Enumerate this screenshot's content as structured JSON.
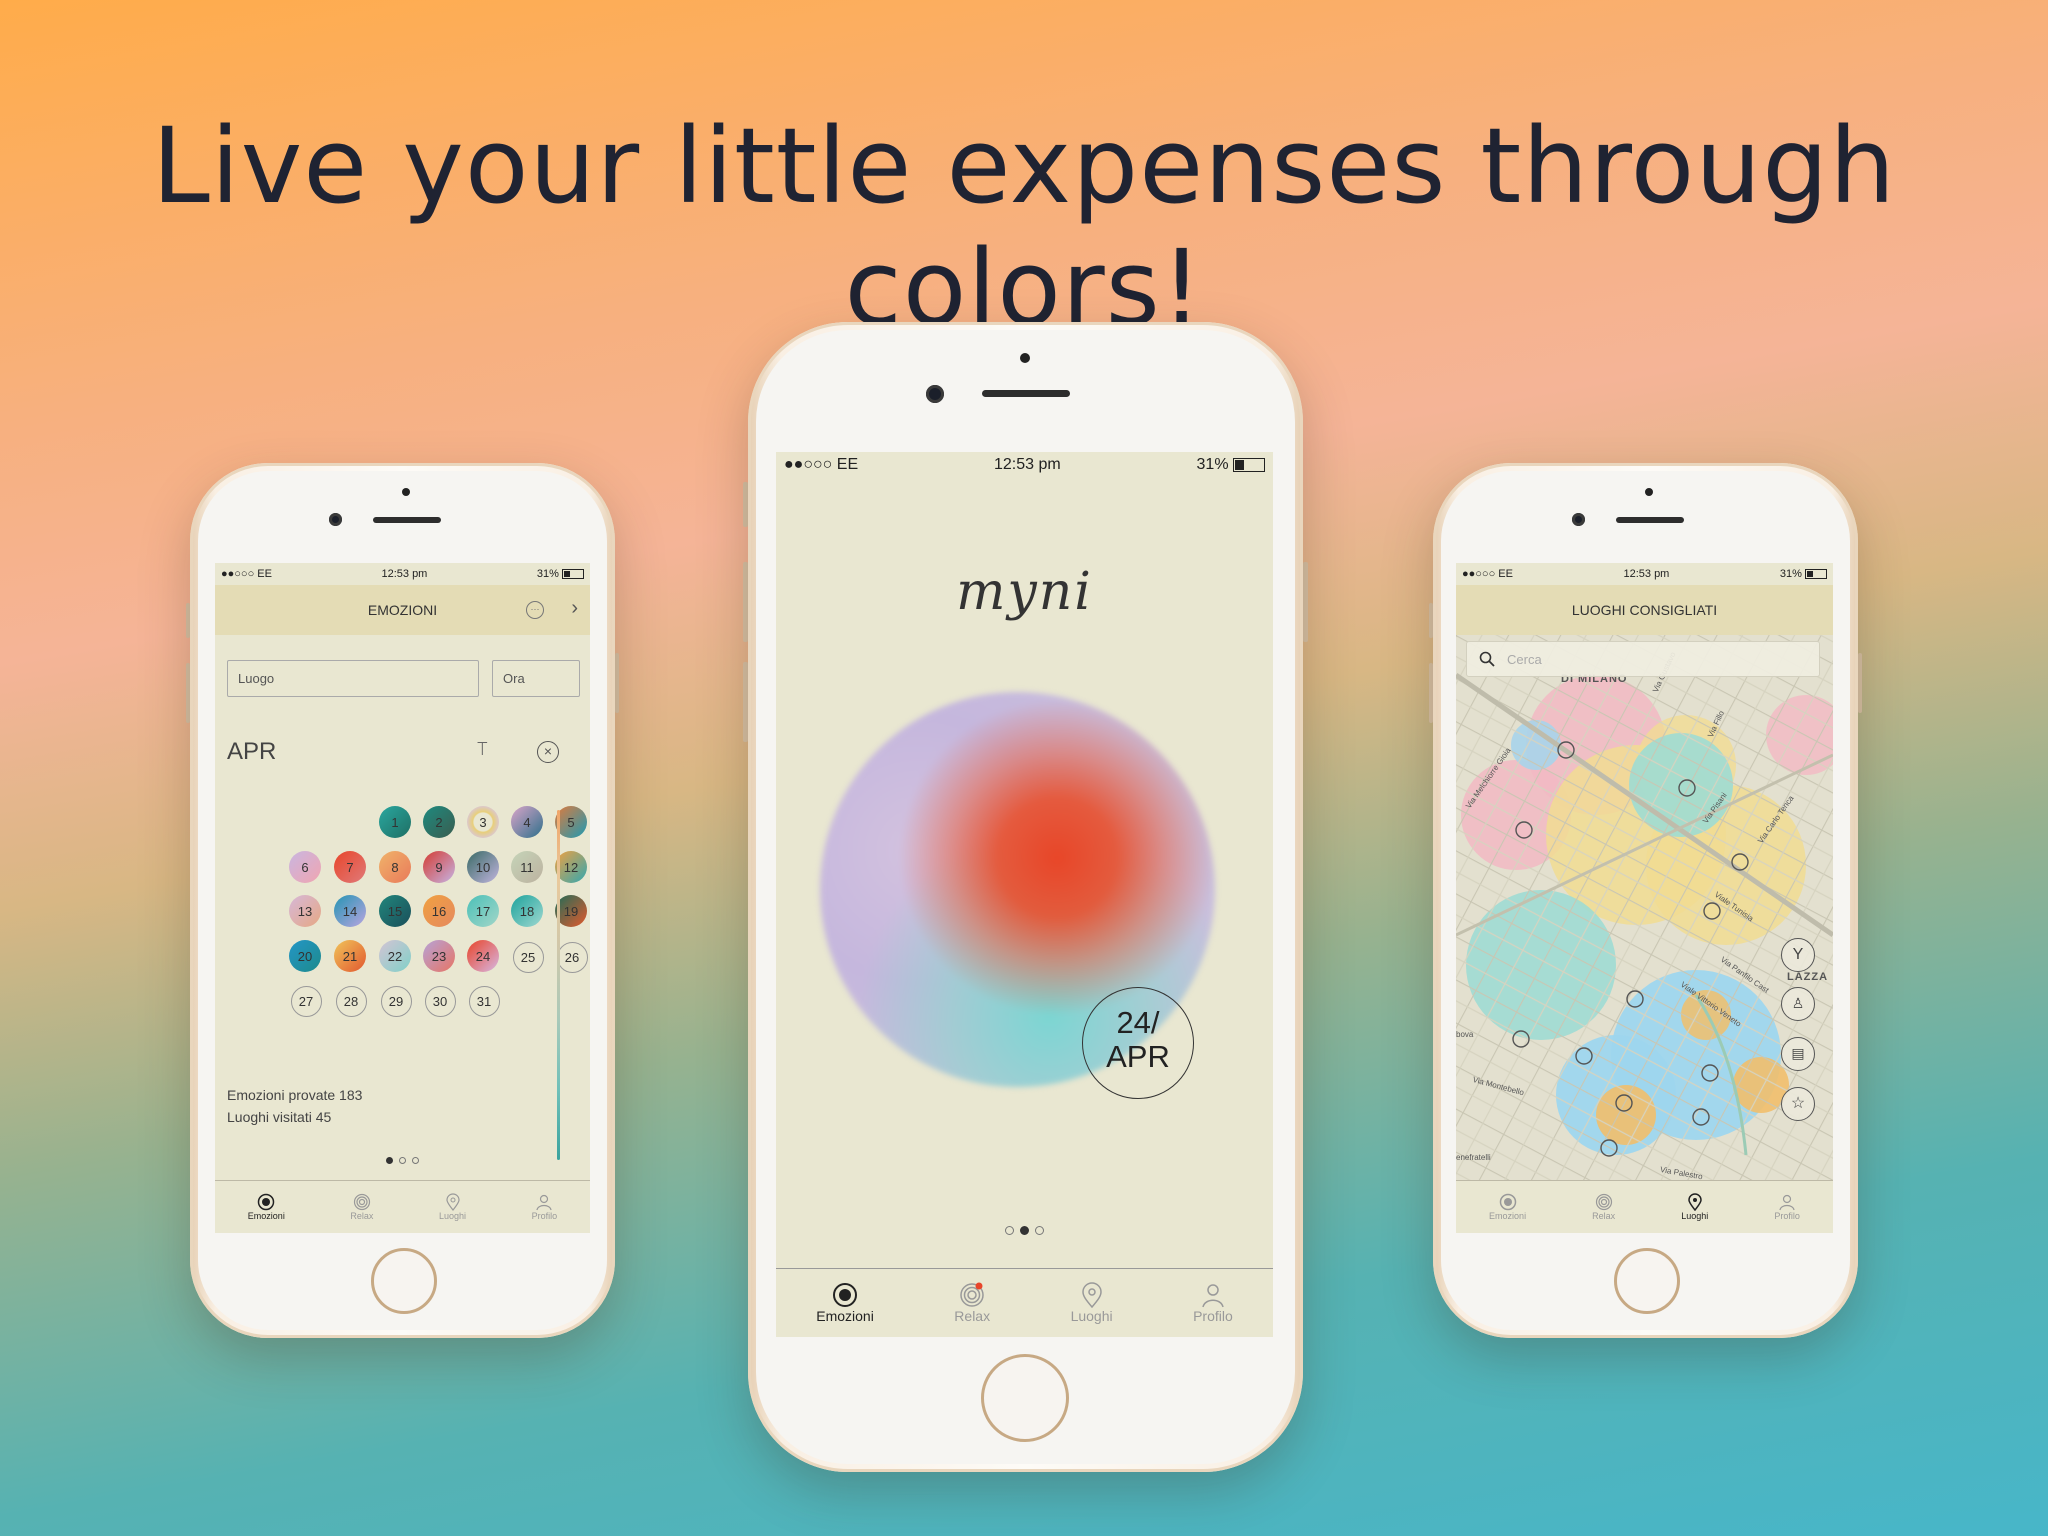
{
  "headline": "Live your little expenses through colors!",
  "status": {
    "signal": "●●○○○ EE",
    "time": "12:53 pm",
    "battery": "31%"
  },
  "left": {
    "title": "EMOZIONI",
    "luogo_placeholder": "Luogo",
    "ora_placeholder": "Ora",
    "month": "APR",
    "days": [
      "1",
      "2",
      "3",
      "4",
      "5",
      "6",
      "7",
      "8",
      "9",
      "10",
      "11",
      "12",
      "13",
      "14",
      "15",
      "16",
      "17",
      "18",
      "19",
      "20",
      "21",
      "22",
      "23",
      "24",
      "25",
      "26",
      "27",
      "28",
      "29",
      "30",
      "31"
    ],
    "stats_line1": "Emozioni provate 183",
    "stats_line2": "Luoghi visitati 45"
  },
  "center": {
    "logo": "myni",
    "date_line1": "24/",
    "date_line2": "APR"
  },
  "right": {
    "title": "LUOGHI CONSIGLIATI",
    "search_placeholder": "Cerca",
    "map_labels": {
      "milano": "DI MILANO",
      "gustavo": "Via Gustavo",
      "fillo": "Via Fillo",
      "melchiorre": "Via Melchiorre Gioia",
      "pisani": "Via Pisani",
      "carlo": "Via Carlo Tenca",
      "tunisia": "Viale Tunisia",
      "panfilo": "Via Panfilo Cast",
      "vittorio": "Viale Vittorio Veneto",
      "lazza": "LAZZA",
      "montebello": "Via Montebello",
      "palestro": "Via Palestro",
      "fatebene": "enefratelli",
      "bova": "bova"
    }
  },
  "tabs": [
    "Emozioni",
    "Relax",
    "Luoghi",
    "Profilo"
  ],
  "colors": {
    "screen_bg": "#e9e7d1",
    "nav_bg": "#e4dcb5",
    "accent_red": "#e8452a"
  }
}
